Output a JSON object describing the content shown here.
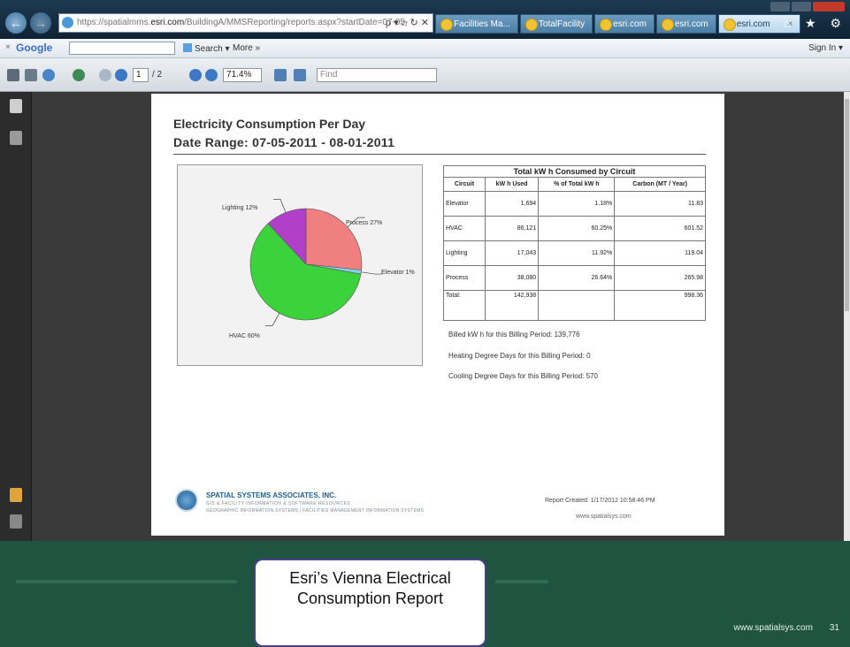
{
  "browser": {
    "url_prefix": "https://spatialmms.",
    "url_domain": "esri.com",
    "url_rest": "/BuildingA/MMSReporting/reports.aspx?startDate=07-05-",
    "url_controls": "ρ ▾ ⌂ ↻ ✕",
    "tabs": [
      {
        "label": "Facilities Ma...",
        "active": false
      },
      {
        "label": "TotalFacility",
        "active": false
      },
      {
        "label": "esri.com",
        "active": false
      },
      {
        "label": "esri.com",
        "active": false
      },
      {
        "label": "esri.com",
        "active": true,
        "close": "×"
      }
    ],
    "home_icons": "⌂ ★ ⚙"
  },
  "googlebar": {
    "close": "×",
    "logo": "Google",
    "search_label": "Search ▾",
    "more_label": "More »",
    "sign_in": "Sign In ▾"
  },
  "pdf_toolbar": {
    "page_current": "1",
    "page_total": "/ 2",
    "zoom": "71.4%",
    "find_placeholder": "Find"
  },
  "report": {
    "title": "Electricity Consumption Per Day",
    "date_range": "Date Range: 07-05-2011 - 08-01-2011",
    "table_title": "Total kW h Consumed by Circuit",
    "headers": [
      "Circuit",
      "kW h Used",
      "% of Total kW h",
      "Carbon (MT / Year)"
    ],
    "rows": [
      {
        "circuit": "Elevator",
        "kwh": "1,694",
        "pct": "1.18%",
        "carbon": "11.83"
      },
      {
        "circuit": "HVAC",
        "kwh": "86,121",
        "pct": "60.25%",
        "carbon": "601.52"
      },
      {
        "circuit": "Lighting",
        "kwh": "17,043",
        "pct": "11.92%",
        "carbon": "119.04"
      },
      {
        "circuit": "Process",
        "kwh": "38,080",
        "pct": "26.64%",
        "carbon": "265.98"
      }
    ],
    "total": {
      "label": "Total:",
      "kwh": "142,938",
      "pct": "",
      "carbon": "998.36"
    },
    "billed": "Billed kW h for this Billing Period:   139,776",
    "heating": "Heating Degree Days for this Billing Period: 0",
    "cooling": "Cooling Degree Days for this Billing Period: 570",
    "company": "SPATIAL SYSTEMS ASSOCIATES, INC.",
    "company_sub1": "GIS & FACILITY INFORMATION & SOFTWARE RESOURCES",
    "company_sub2": "GEOGRAPHIC INFORMATION SYSTEMS | FACILITIES MANAGEMENT INFORMATION SYSTEMS",
    "report_created": "Report Created: 1/17/2012 10:58:46 PM",
    "website": "www.spatialsys.com"
  },
  "chart_data": {
    "type": "pie",
    "slices": [
      {
        "label": "Process 27%",
        "value": 26.64,
        "color": "#f08080"
      },
      {
        "label": "Elevator 1%",
        "value": 1.18,
        "color": "#87ceeb"
      },
      {
        "label": "HVAC 60%",
        "value": 60.25,
        "color": "#3cd23c"
      },
      {
        "label": "Lighting 12%",
        "value": 11.92,
        "color": "#b040c8"
      }
    ]
  },
  "slide": {
    "caption": "Esri’s Vienna Electrical Consumption Report",
    "footer_url": "www.spatialsys.com",
    "page_number": "31"
  }
}
